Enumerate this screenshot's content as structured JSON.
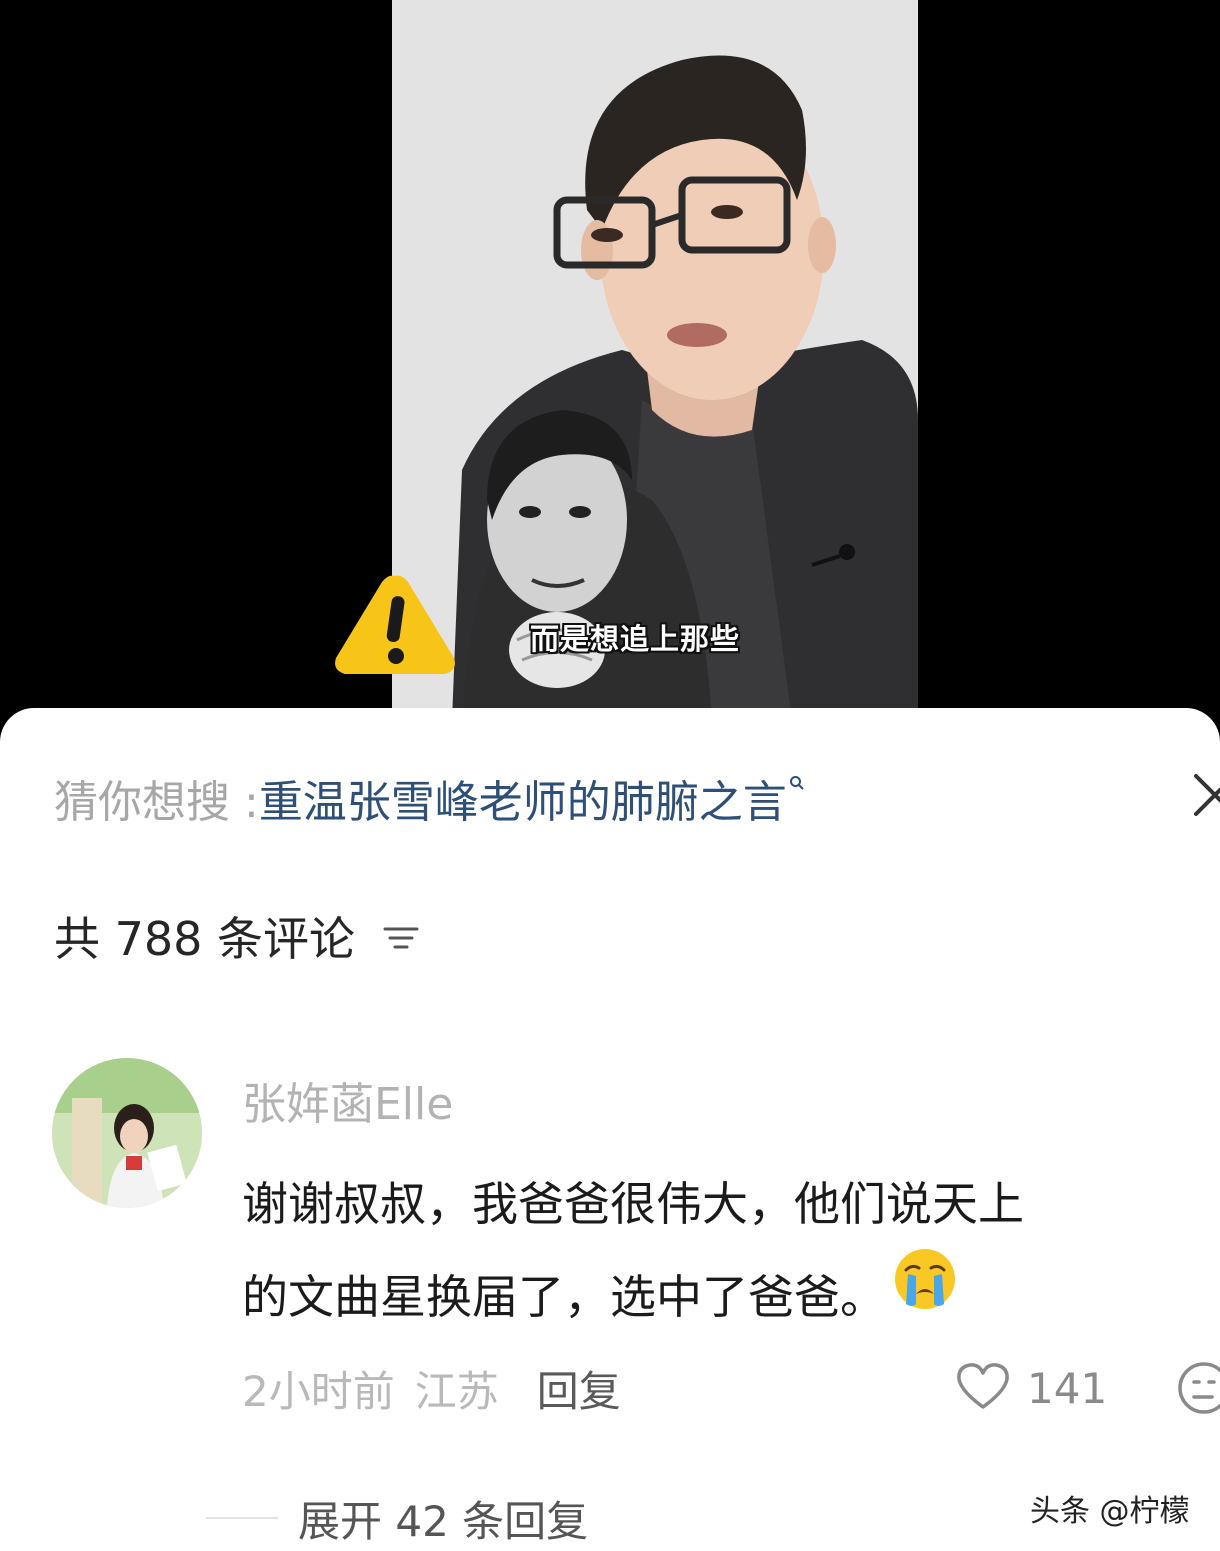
{
  "video": {
    "subtitle": "而是想追上那些"
  },
  "search_suggest": {
    "prefix": "猜你想搜 : ",
    "query": "重温张雪峰老师的肺腑之言"
  },
  "comments_header": {
    "count_text": "共 788 条评论"
  },
  "comment": {
    "username": "张姩菡Elle",
    "text_line1": "谢谢叔叔，我爸爸很伟大，他们说天上",
    "text_line2": "的文曲星换届了，选中了爸爸。",
    "time": "2小时前",
    "location": "江苏",
    "reply_label": "回复",
    "like_count": "141",
    "expand_label": "展开 42 条回复"
  },
  "watermark": "头条 @柠檬",
  "colors": {
    "query_link": "#2d4f78",
    "muted_text": "#b3b3b3",
    "body_text": "#1b1b1b",
    "warning_yellow": "#f7c518"
  },
  "icons": [
    "warning-icon",
    "search-icon",
    "close-icon",
    "sort-icon",
    "heart-icon",
    "crying-emoji-icon",
    "dislike-icon"
  ]
}
